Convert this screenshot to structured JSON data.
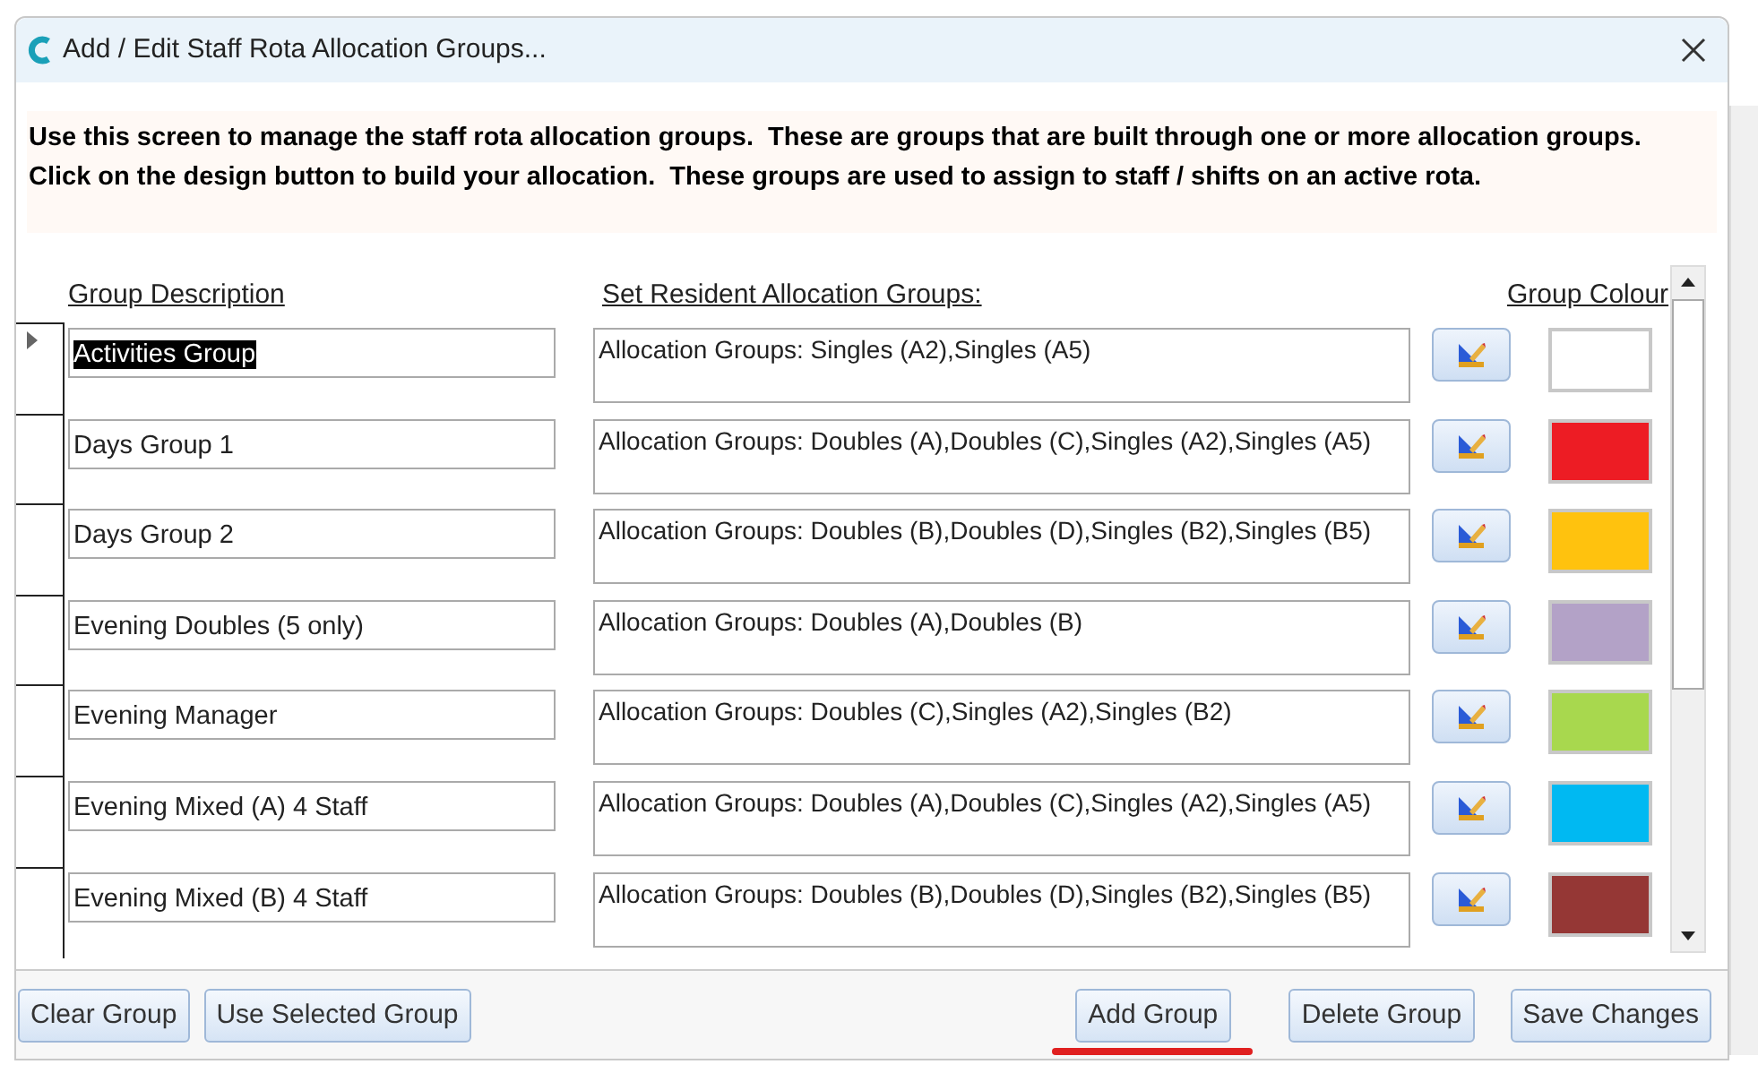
{
  "window": {
    "title": "Add / Edit Staff Rota Allocation Groups..."
  },
  "instructions": "Use this screen to manage the staff rota allocation groups.  These are groups that are built through one or more allocation groups.  Click on the design button to build your allocation.  These groups are used to assign to staff / shifts on an active rota.",
  "table": {
    "columns": [
      "Group Description",
      "Set Resident Allocation Groups:",
      "Group Colour"
    ],
    "rows": [
      {
        "description": "Activities Group",
        "allocation": "Allocation Groups: Singles (A2),Singles (A5)",
        "color": "#ffffff",
        "selected": true
      },
      {
        "description": "Days Group 1",
        "allocation": "Allocation Groups: Doubles (A),Doubles (C),Singles (A2),Singles (A5)",
        "color": "#ed1c24",
        "selected": false
      },
      {
        "description": "Days Group 2",
        "allocation": "Allocation Groups: Doubles (B),Doubles (D),Singles (B2),Singles (B5)",
        "color": "#ffc20e",
        "selected": false
      },
      {
        "description": "Evening Doubles (5 only)",
        "allocation": "Allocation Groups: Doubles (A),Doubles (B)",
        "color": "#b3a2c7",
        "selected": false
      },
      {
        "description": "Evening Manager",
        "allocation": "Allocation Groups: Doubles (C),Singles (A2),Singles (B2)",
        "color": "#a8d84e",
        "selected": false
      },
      {
        "description": "Evening Mixed (A) 4 Staff",
        "allocation": "Allocation Groups: Doubles (A),Doubles (C),Singles (A2),Singles (A5)",
        "color": "#00b9f2",
        "selected": false
      },
      {
        "description": "Evening Mixed (B) 4 Staff",
        "allocation": "Allocation Groups: Doubles (B),Doubles (D),Singles (B2),Singles (B5)",
        "color": "#953735",
        "selected": false
      }
    ]
  },
  "buttons": [
    {
      "label": "Clear Group",
      "highlighted": false
    },
    {
      "label": "Use Selected Group",
      "highlighted": false
    },
    {
      "label": "Add Group",
      "highlighted": true
    },
    {
      "label": "Delete Group",
      "highlighted": false
    },
    {
      "label": "Save Changes",
      "highlighted": false
    }
  ]
}
